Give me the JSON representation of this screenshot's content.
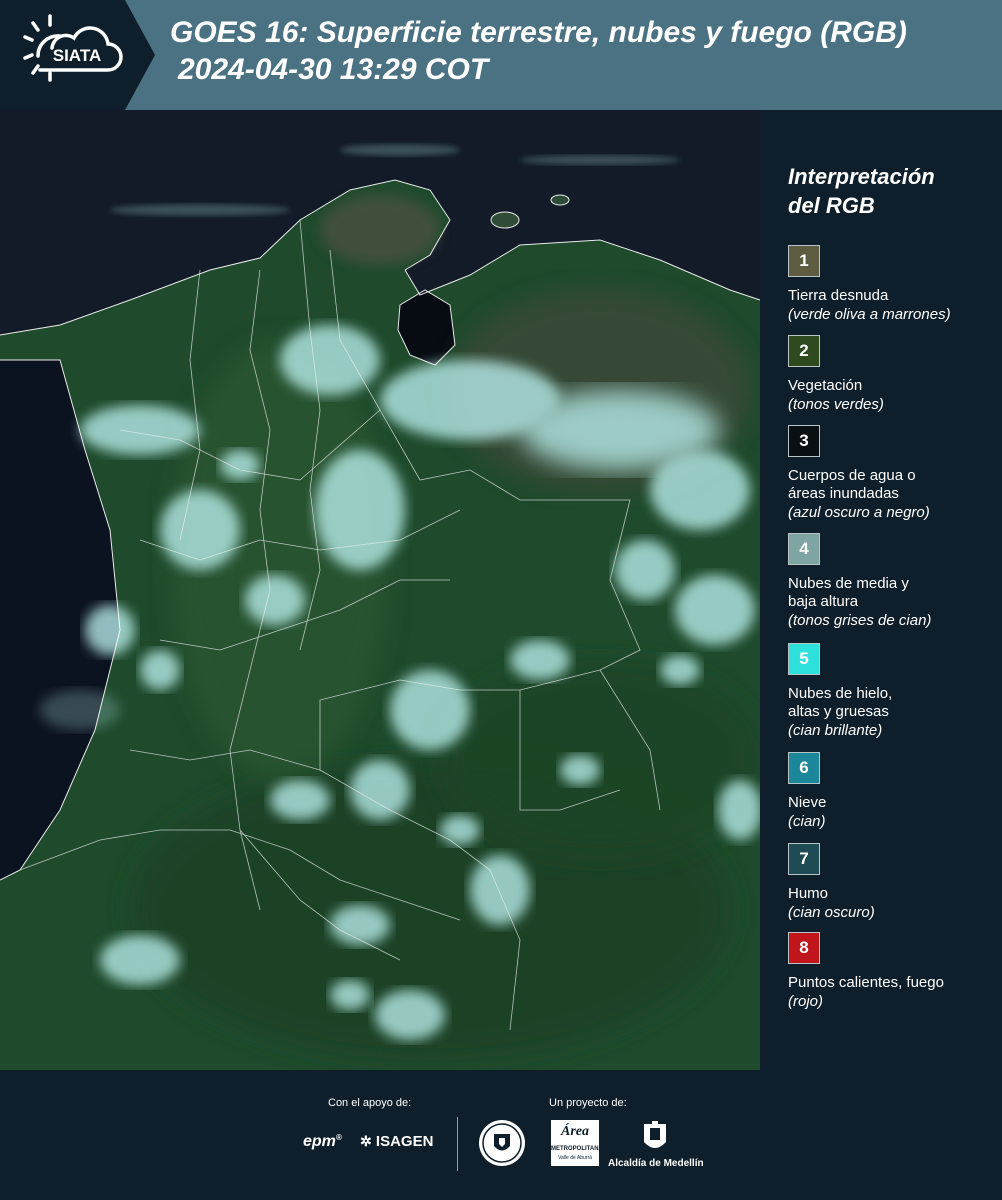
{
  "header": {
    "logo_text": "SIATA",
    "title_line1": "GOES 16: Superficie terrestre, nubes y fuego (RGB)",
    "title_line2": "2024-04-30 13:29 COT"
  },
  "legend": {
    "title_line1": "Interpretación",
    "title_line2": "del RGB",
    "items": [
      {
        "num": "1",
        "color": "#5e5c40",
        "label_lines": [
          "Tierra desnuda"
        ],
        "desc": "(verde oliva a marrones)"
      },
      {
        "num": "2",
        "color": "#2e4a1e",
        "label_lines": [
          "Vegetación"
        ],
        "desc": "(tonos verdes)"
      },
      {
        "num": "3",
        "color": "#0a0f14",
        "label_lines": [
          "Cuerpos de agua o",
          "áreas inundadas"
        ],
        "desc": "(azul oscuro a negro)"
      },
      {
        "num": "4",
        "color": "#7fa5a3",
        "label_lines": [
          "Nubes de media y",
          "baja altura"
        ],
        "desc": "(tonos grises de cian)"
      },
      {
        "num": "5",
        "color": "#2ee0dc",
        "label_lines": [
          "Nubes de hielo,",
          "altas y gruesas"
        ],
        "desc": "(cian brillante)"
      },
      {
        "num": "6",
        "color": "#1c8799",
        "label_lines": [
          "Nieve"
        ],
        "desc": "(cian)"
      },
      {
        "num": "7",
        "color": "#1f4c54",
        "label_lines": [
          "Humo"
        ],
        "desc": "(cian oscuro)"
      },
      {
        "num": "8",
        "color": "#c0161b",
        "label_lines": [
          "Puntos calientes, fuego"
        ],
        "desc": "(rojo)"
      }
    ]
  },
  "footer": {
    "support_label": "Con el apoyo de:",
    "project_label": "Un proyecto de:",
    "sponsor1": "epm",
    "sponsor2": "ISAGEN",
    "partner1_line1": "Área",
    "partner1_line2": "METROPOLITANA",
    "partner1_line3": "Valle de Aburrá",
    "partner2": "Alcaldía de Medellín"
  }
}
